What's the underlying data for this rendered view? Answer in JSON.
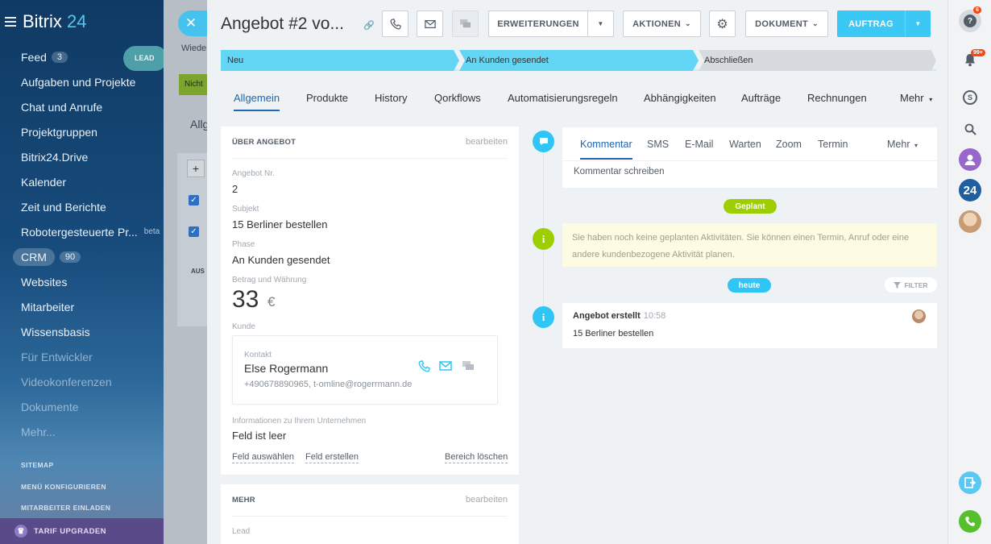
{
  "sidebar": {
    "logo": {
      "name": "Bitrix",
      "num": "24"
    },
    "lead_badge": "LEAD",
    "items": [
      {
        "label": "Feed",
        "count": "3"
      },
      {
        "label": "Aufgaben und Projekte"
      },
      {
        "label": "Chat und Anrufe"
      },
      {
        "label": "Projektgruppen"
      },
      {
        "label": "Bitrix24.Drive"
      },
      {
        "label": "Kalender"
      },
      {
        "label": "Zeit und Berichte"
      },
      {
        "label": "Robotergesteuerte Pr...",
        "tag": "beta"
      },
      {
        "label": "CRM",
        "count": "90"
      },
      {
        "label": "Websites"
      },
      {
        "label": "Mitarbeiter"
      },
      {
        "label": "Wissensbasis"
      },
      {
        "label": "Für Entwickler"
      },
      {
        "label": "Videokonferenzen"
      },
      {
        "label": "Dokumente"
      },
      {
        "label": "Mehr..."
      }
    ],
    "sitemap": "SITEMAP",
    "configure": "MENÜ KONFIGURIEREN",
    "invite": "MITARBEITER EINLADEN",
    "upgrade": "TARIF UPGRADEN"
  },
  "background": {
    "wied": "Wiede",
    "nicht": "Nicht",
    "allg": "Allg",
    "plus": "+",
    "aus": "AUS"
  },
  "header": {
    "title": "Angebot #2 vo...",
    "erweiterungen": "ERWEITERUNGEN",
    "aktionen": "AKTIONEN",
    "dokument": "DOKUMENT",
    "auftrag": "AUFTRAG"
  },
  "stages": [
    {
      "label": "Neu",
      "color": "#62d6f4"
    },
    {
      "label": "An Kunden gesendet",
      "color": "#62d6f4"
    },
    {
      "label": "Abschließen",
      "color": "#d7dbdf"
    }
  ],
  "tabs": [
    "Allgemein",
    "Produkte",
    "History",
    "Qorkflows",
    "Automatisierungsregeln",
    "Abhängigkeiten",
    "Aufträge",
    "Rechnungen",
    "Mehr"
  ],
  "about": {
    "heading": "ÜBER ANGEBOT",
    "edit": "bearbeiten",
    "nr_label": "Angebot Nr.",
    "nr_value": "2",
    "subject_label": "Subjekt",
    "subject_value": "15 Berliner bestellen",
    "phase_label": "Phase",
    "phase_value": "An Kunden gesendet",
    "amount_label": "Betrag und Währung",
    "amount_value": "33",
    "currency": "€",
    "client_label": "Kunde",
    "contact_label": "Kontakt",
    "contact_name": "Else Rogermann",
    "contact_info": "+490678890965, t-omline@rogerrmann.de",
    "company_label": "Informationen zu Ihrem Unternehmen",
    "company_value": "Feld ist leer",
    "select_field": "Feld auswählen",
    "create_field": "Feld erstellen",
    "delete_section": "Bereich löschen"
  },
  "more_card": {
    "heading": "MEHR",
    "edit": "bearbeiten",
    "lead_label": "Lead"
  },
  "editor": {
    "tabs": [
      "Kommentar",
      "SMS",
      "E-Mail",
      "Warten",
      "Zoom",
      "Termin",
      "Mehr"
    ],
    "placeholder": "Kommentar schreiben"
  },
  "timeline": {
    "planned_pill": "Geplant",
    "planned_text": "Sie haben noch keine geplanten Aktivitäten. Sie können einen Termin, Anruf oder eine andere kundenbezogene Aktivität planen.",
    "today_pill": "heute",
    "filter": "FILTER",
    "activity_title": "Angebot erstellt",
    "activity_time": "10:58",
    "activity_desc": "15 Berliner bestellen"
  },
  "rightbar": {
    "help_badge": "6",
    "notif_badge": "99+",
    "user_num": "24"
  },
  "colors": {
    "accent": "#3bc8f5",
    "link_blue": "#2067b0",
    "green_pill": "#9dcf00",
    "cyan_pill": "#2fc6f6"
  }
}
